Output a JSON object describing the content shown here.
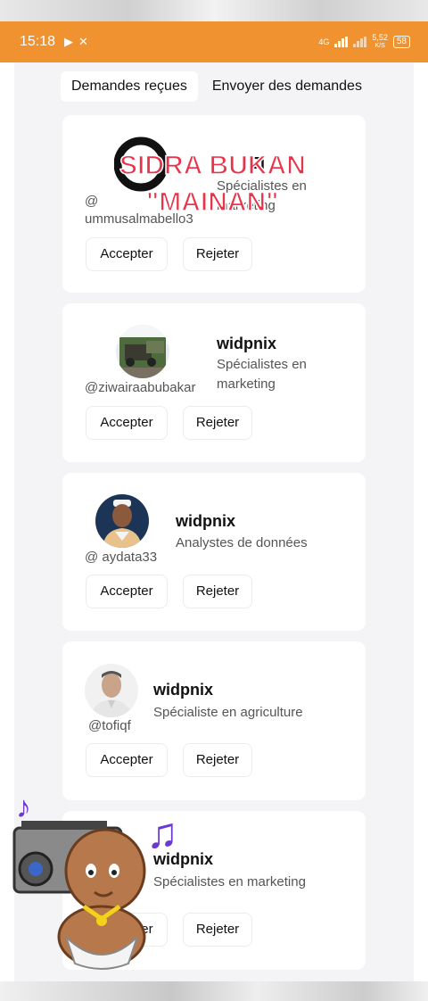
{
  "status_bar": {
    "time": "15:18",
    "net_speed_top": "5,52",
    "net_speed_bottom": "K/S",
    "network_type": "4G",
    "battery": "58"
  },
  "tabs": [
    {
      "label": "Demandes reçues",
      "active": true
    },
    {
      "label": "Envoyer des demandes",
      "active": false
    }
  ],
  "requests": [
    {
      "name": "Ji",
      "role": "Spécialistes en marketing",
      "handle": "@ ummusalmabello3",
      "accept": "Accepter",
      "reject": "Rejeter"
    },
    {
      "name": "widpnix",
      "role": "Spécialistes en marketing",
      "handle": "@ziwairaabubakar",
      "accept": "Accepter",
      "reject": "Rejeter"
    },
    {
      "name": "widpnix",
      "role": "Analystes de données",
      "handle": "@ aydata33",
      "accept": "Accepter",
      "reject": "Rejeter"
    },
    {
      "name": "widpnix",
      "role": "Spécialiste en agriculture",
      "handle": "@tofiqf",
      "accept": "Accepter",
      "reject": "Rejeter"
    },
    {
      "name": "widpnix",
      "role": "Spécialistes en marketing",
      "handle": "",
      "accept": "Accepter",
      "reject": "Rejeter"
    }
  ],
  "overlay": {
    "watermark_line1": "SIDRA BUKAN",
    "watermark_line2": "\"MAINAN\"",
    "watermark_color": "#e8334a"
  },
  "colors": {
    "status_bar": "#f0922f",
    "background": "#f4f4f6",
    "card": "#ffffff"
  }
}
